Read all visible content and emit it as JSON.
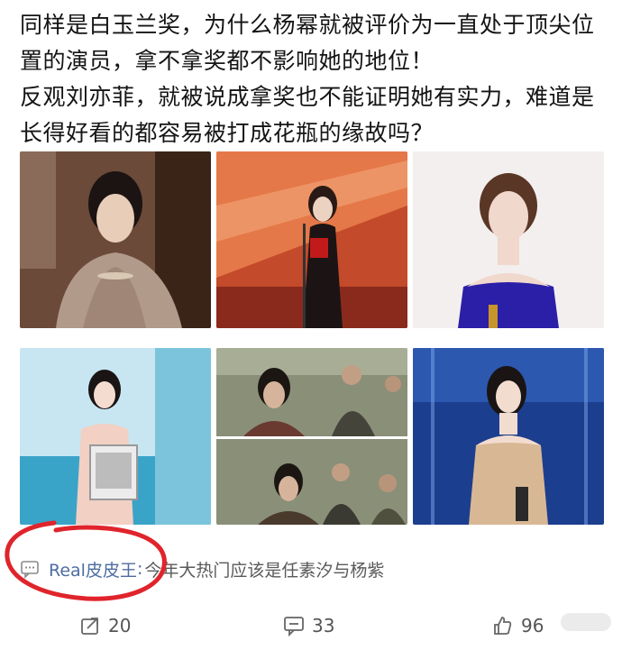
{
  "post": {
    "lines": [
      "同样是白玉兰奖，为什么杨幂就被评价为一直处于顶尖位",
      "置的演员，拿不拿奖都不影响她的地位！",
      "反观刘亦菲，就被说成拿奖也不能证明她有实力，难道是",
      "长得好看的都容易被打成花瓶的缘故吗？"
    ]
  },
  "photos": [
    {
      "icon": "photo-woman-shawl"
    },
    {
      "icon": "photo-award-stage-red"
    },
    {
      "icon": "photo-woman-blue-gown-trophy"
    },
    {
      "icon": "photo-woman-podium-award"
    },
    {
      "icon": "photo-drama-stills"
    },
    {
      "icon": "photo-woman-gold-gown"
    }
  ],
  "hot_comment": {
    "user": "Real皮皮王",
    "separator": ":",
    "text": " 今年大热门应该是任素汐与杨紫",
    "icon": "comment-bubble-icon"
  },
  "actions": {
    "repost": {
      "count": "20",
      "icon": "repost-icon"
    },
    "comment": {
      "count": "33",
      "icon": "comment-icon"
    },
    "like": {
      "count": "96",
      "icon": "thumbs-up-icon"
    }
  },
  "colors": {
    "username": "#4e6da1",
    "annotation": "#e0242c",
    "text": "#141414"
  }
}
